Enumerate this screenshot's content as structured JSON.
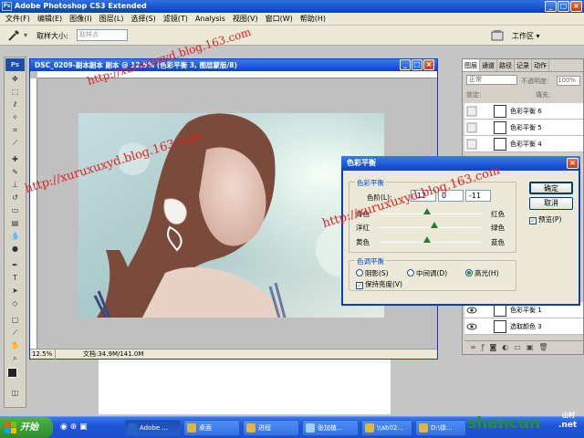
{
  "app": {
    "title": "Adobe Photoshop CS3 Extended",
    "logo": "Ps"
  },
  "menu": [
    "文件(F)",
    "编辑(E)",
    "图像(I)",
    "图层(L)",
    "选择(S)",
    "滤镜(T)",
    "Analysis",
    "视图(V)",
    "窗口(W)",
    "帮助(H)"
  ],
  "options": {
    "sample_label": "取样大小:",
    "sample_value": "取样点",
    "workspace_label": "工作区 ▾"
  },
  "toolbox": {
    "logo": "Ps"
  },
  "document": {
    "title": "DSC_0209-副本副本 副本 @ 12.5% (色彩平衡 3, 图层蒙版/8)",
    "zoom": "12.5%",
    "size": "文档:34.9M/141.0M"
  },
  "layers": {
    "tabs": [
      "图层",
      "通道",
      "路径",
      "记录",
      "动作"
    ],
    "blend_mode": "正常",
    "opacity_label": "不透明度:",
    "opacity_value": "100%",
    "lock_label": "锁定:",
    "fill_label": "填充:",
    "items": [
      {
        "name": "色彩平衡 6",
        "visible": false
      },
      {
        "name": "色彩平衡 5",
        "visible": false
      },
      {
        "name": "色彩平衡 4",
        "visible": false
      },
      {
        "name": "色彩平衡 1",
        "visible": true
      },
      {
        "name": "选取颜色 3",
        "visible": true
      }
    ]
  },
  "color_balance": {
    "title": "色彩平衡",
    "group1_title": "色彩平衡",
    "levels_label": "色阶(L):",
    "levels": [
      "-12",
      "0",
      "-11"
    ],
    "sliders": [
      {
        "left": "青色",
        "right": "红色",
        "value": -12
      },
      {
        "left": "洋红",
        "right": "绿色",
        "value": 0
      },
      {
        "left": "黄色",
        "right": "蓝色",
        "value": -11
      }
    ],
    "group2_title": "色调平衡",
    "tone_options": [
      "阴影(S)",
      "中间调(D)",
      "高光(H)"
    ],
    "tone_selected": 2,
    "preserve_label": "保持亮度(V)",
    "ok": "确定",
    "cancel": "取消",
    "preview": "预览(P)"
  },
  "taskbar": {
    "start": "开始",
    "tasks": [
      "Adobe ...",
      "桌面",
      "进程",
      "张加植...",
      "\\\\ab02...",
      "D:\\徐..."
    ]
  },
  "watermark": {
    "text1": "http://xuruxuxyd.blog.163.com",
    "text2": "http://xuruxuxyd.blog.163.com",
    "text3": "http://xuruxuxyd.blog.163.com",
    "brand": "shancun",
    "brand_sub": ".net",
    "brand_cn": "山村"
  },
  "colors": {
    "xp_blue": "#0b44c2",
    "watermark": "#e02020"
  }
}
